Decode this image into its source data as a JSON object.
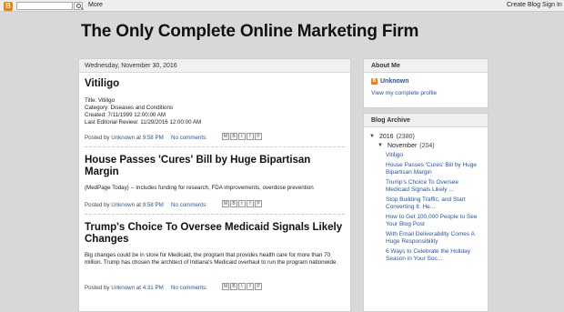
{
  "navbar": {
    "logo": "B",
    "more_label": "More",
    "create_blog_label": "Create Blog",
    "sign_in_label": "Sign In"
  },
  "header": {
    "title": "The Only Complete Online Marketing Firm"
  },
  "main": {
    "date": "Wednesday, November 30, 2016",
    "posts": [
      {
        "title": "Vitiligo",
        "body_lines": [
          "Title: Vitiligo",
          "Category: Diseases and Conditions",
          "Created: 7/11/1999 12:00:00 AM",
          "Last Editorial Review: 11/29/2016 12:00:00 AM"
        ],
        "posted_by": "Posted by",
        "author": "Unknown",
        "at": "at",
        "time": "9:58 PM",
        "comments": "No comments:"
      },
      {
        "title": "House Passes 'Cures' Bill by Huge Bipartisan Margin",
        "body": "(MedPage Today) -- Includes funding for research, FDA improvements, overdose prevention",
        "posted_by": "Posted by",
        "author": "Unknown",
        "at": "at",
        "time": "9:58 PM",
        "comments": "No comments:"
      },
      {
        "title": "Trump's Choice To Oversee Medicaid Signals Likely Changes",
        "body": "Big changes could be in store for Medicaid, the program that provides health care for more than 70 million. Trump has chosen the architect of Indiana's Medicaid overhaul to run the program nationwide.",
        "posted_by": "Posted by",
        "author": "Unknown",
        "at": "at",
        "time": "4:31 PM",
        "comments": "No comments:"
      }
    ],
    "share_icons": [
      "M",
      "B",
      "t",
      "f",
      "P"
    ]
  },
  "about": {
    "title": "About Me",
    "name": "Unknown",
    "profile_link": "View my complete profile"
  },
  "archive": {
    "title": "Blog Archive",
    "year": "2016",
    "year_count": "(2380)",
    "month": "November",
    "month_count": "(204)",
    "posts": [
      "Vitiligo",
      "House Passes 'Cures' Bill by Huge Bipartisan Margin",
      "Trump's Choice To Oversee Medicaid Signals Likely ...",
      "Stop Building Traffic, and Start Converting It. He...",
      "How to Get 100,000 People to See Your Blog Post",
      "With Email Deliverability Comes A Huge Responsibility",
      "6 Ways to Celebrate the Holiday Season in Your Soc..."
    ]
  }
}
